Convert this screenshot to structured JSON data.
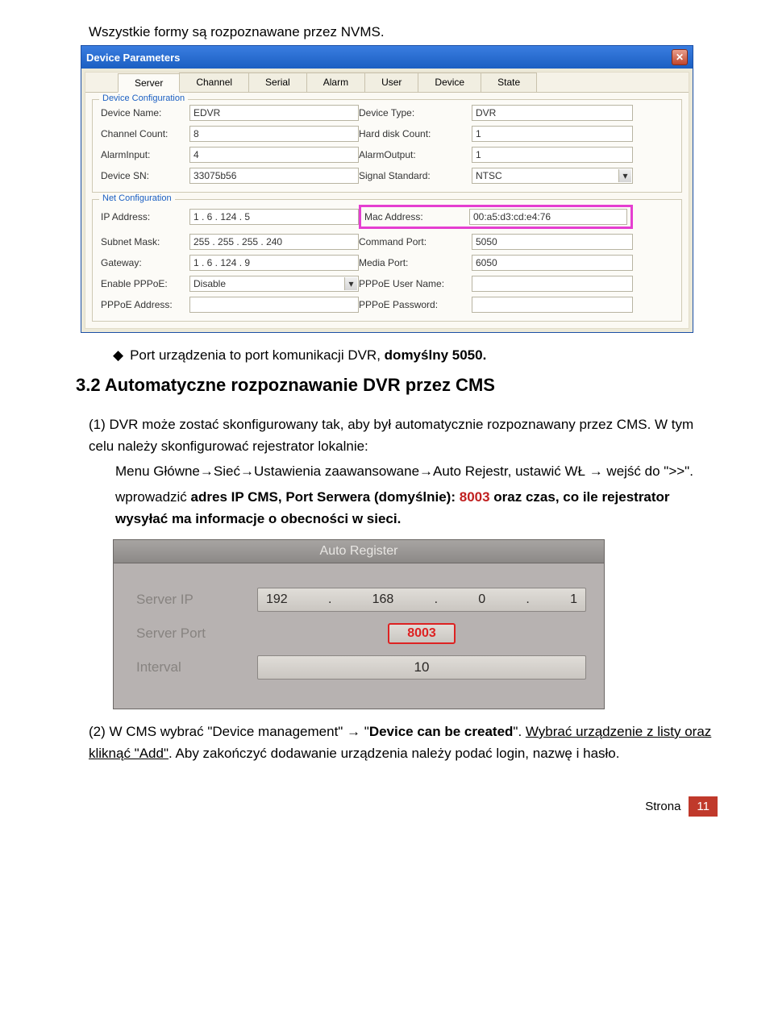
{
  "intro": "Wszystkie formy są rozpoznawane przez NVMS.",
  "dialog": {
    "title": "Device Parameters",
    "tabs": [
      "Server",
      "Channel",
      "Serial",
      "Alarm",
      "User",
      "Device",
      "State"
    ],
    "device_config": {
      "legend": "Device Configuration",
      "device_name_lbl": "Device Name:",
      "device_name": "EDVR",
      "device_type_lbl": "Device Type:",
      "device_type": "DVR",
      "channel_count_lbl": "Channel Count:",
      "channel_count": "8",
      "hdd_count_lbl": "Hard disk Count:",
      "hdd_count": "1",
      "alarm_in_lbl": "AlarmInput:",
      "alarm_in": "4",
      "alarm_out_lbl": "AlarmOutput:",
      "alarm_out": "1",
      "device_sn_lbl": "Device SN:",
      "device_sn": "33075b56",
      "signal_std_lbl": "Signal Standard:",
      "signal_std": "NTSC"
    },
    "net_config": {
      "legend": "Net Configuration",
      "ip_lbl": "IP Address:",
      "ip": "1    .    6  . 124  .   5",
      "mac_lbl": "Mac Address:",
      "mac": "00:a5:d3:cd:e4:76",
      "subnet_lbl": "Subnet Mask:",
      "subnet": "255  . 255  . 255  . 240",
      "cmd_port_lbl": "Command Port:",
      "cmd_port": "5050",
      "gateway_lbl": "Gateway:",
      "gateway": "1    .    6  . 124  .   9",
      "media_port_lbl": "Media Port:",
      "media_port": "6050",
      "pppoe_en_lbl": "Enable PPPoE:",
      "pppoe_en": "Disable",
      "pppoe_user_lbl": "PPPoE User Name:",
      "pppoe_user": "",
      "pppoe_addr_lbl": "PPPoE Address:",
      "pppoe_addr": "",
      "pppoe_pw_lbl": "PPPoE Password:",
      "pppoe_pw": ""
    }
  },
  "bullet": {
    "text_a": "Port urządzenia to port komunikacji DVR, ",
    "text_b": "domyślny 5050."
  },
  "heading": "3.2 Automatyczne rozpoznawanie DVR przez CMS",
  "para1": {
    "intro": "(1) DVR może zostać skonfigurowany tak, aby był automatycznie rozpoznawany przez CMS. W tym celu należy skonfigurować rejestrator lokalnie:",
    "menu": "Menu Główne→Sieć→Ustawienia zaawansowane→Auto Rejestr, ustawić WŁ → wejść do \">>\".",
    "wprow_a": "wprowadzić ",
    "wprow_b": "adres IP CMS, Port Serwera (domyślnie): ",
    "port_num": "8003 ",
    "wprow_c": "oraz czas, co ile rejestrator wysyłać ma informacje o obecności w sieci."
  },
  "reg_panel": {
    "title": "Auto Register",
    "server_ip_lbl": "Server IP",
    "server_ip": [
      "192",
      "168",
      "0",
      "1"
    ],
    "server_port_lbl": "Server Port",
    "server_port": "8003",
    "interval_lbl": "Interval",
    "interval": "10"
  },
  "para2": {
    "a": "(2) W CMS wybrać \"Device management\" → \"",
    "b": "Device can be created",
    "c": "\". ",
    "d": "Wybrać urządzenie z listy oraz kliknąć \"Add\"",
    "e": ". Aby zakończyć dodawanie urządzenia należy podać login, nazwę i hasło."
  },
  "footer": {
    "label": "Strona",
    "num": "11"
  }
}
